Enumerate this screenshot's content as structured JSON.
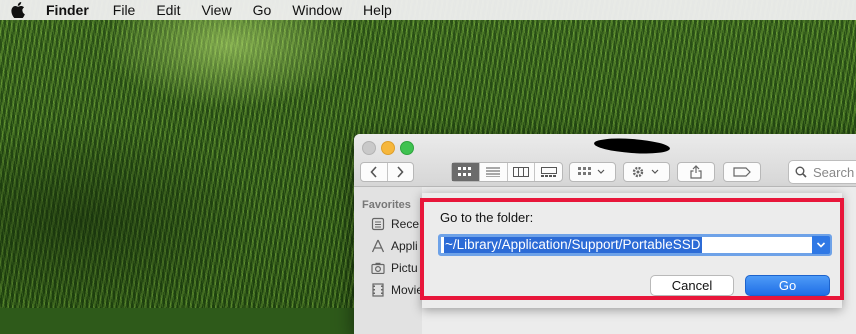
{
  "menubar": {
    "app_name": "Finder",
    "items": [
      "File",
      "Edit",
      "View",
      "Go",
      "Window",
      "Help"
    ]
  },
  "finder": {
    "search_placeholder": "Search",
    "sidebar": {
      "heading": "Favorites",
      "items": [
        {
          "label": "Rece",
          "icon": "recents-icon"
        },
        {
          "label": "Appli",
          "icon": "applications-icon"
        },
        {
          "label": "Pictu",
          "icon": "pictures-icon"
        },
        {
          "label": "Movie",
          "icon": "movies-icon"
        }
      ]
    }
  },
  "goto_dialog": {
    "label": "Go to the folder:",
    "path_value": "~/Library/Application/Support/PortableSSD",
    "cancel_label": "Cancel",
    "go_label": "Go"
  },
  "colors": {
    "highlight_border": "#e8163a",
    "primary_button": "#1f6ee6",
    "selection": "#2c6bd6"
  }
}
